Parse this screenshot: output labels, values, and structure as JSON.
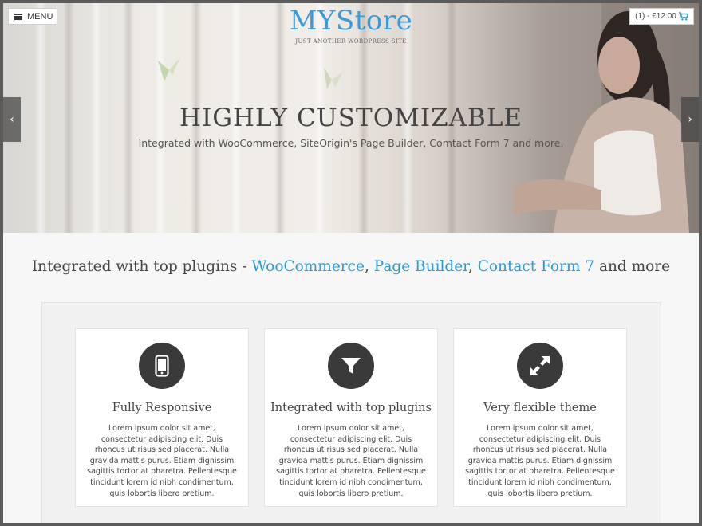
{
  "header": {
    "menu_label": "MENU",
    "cart_label": "(1) - £12.00",
    "logo": "MYStore",
    "tagline": "JUST ANOTHER WORDPRESS SITE"
  },
  "hero": {
    "title": "HIGHLY CUSTOMIZABLE",
    "subtitle": "Integrated with WooCommerce, SiteOrigin's Page Builder, Comtact Form 7 and more.",
    "prev_icon": "‹",
    "next_icon": "›"
  },
  "section": {
    "prefix": "Integrated with top plugins - ",
    "link1": "WooCommerce",
    "sep1": ", ",
    "link2": "Page Builder",
    "sep2": ", ",
    "link3": "Contact Form 7",
    "suffix": " and more"
  },
  "features": [
    {
      "icon": "mobile-phone-icon",
      "title": "Fully Responsive",
      "text": "Lorem ipsum dolor sit amet, consectetur adipiscing elit. Duis rhoncus ut risus sed placerat. Nulla gravida mattis purus. Etiam dignissim sagittis tortor at pharetra. Pellentesque tincidunt lorem id nibh condimentum, quis lobortis libero pretium."
    },
    {
      "icon": "filter-icon",
      "title": "Integrated with top plugins",
      "text": "Lorem ipsum dolor sit amet, consectetur adipiscing elit. Duis rhoncus ut risus sed placerat. Nulla gravida mattis purus. Etiam dignissim sagittis tortor at pharetra. Pellentesque tincidunt lorem id nibh condimentum, quis lobortis libero pretium."
    },
    {
      "icon": "expand-arrows-icon",
      "title": "Very flexible theme",
      "text": "Lorem ipsum dolor sit amet, consectetur adipiscing elit. Duis rhoncus ut risus sed placerat. Nulla gravida mattis purus. Etiam dignissim sagittis tortor at pharetra. Pellentesque tincidunt lorem id nibh condimentum, quis lobortis libero pretium."
    }
  ],
  "colors": {
    "accent": "#3a9bd8",
    "icon_circle": "#3b3a3a",
    "text": "#444444"
  }
}
